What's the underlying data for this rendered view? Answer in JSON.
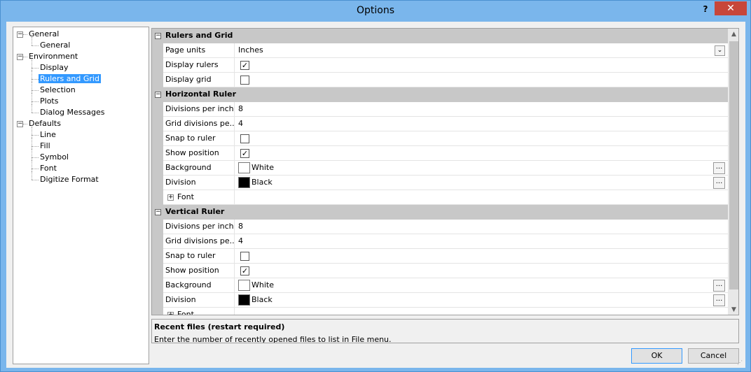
{
  "window": {
    "title": "Options",
    "help_label": "?",
    "close_label": "✕"
  },
  "tree": [
    {
      "label": "General",
      "level": 0,
      "expander": "−"
    },
    {
      "label": "General",
      "level": 1
    },
    {
      "label": "Environment",
      "level": 0,
      "expander": "−"
    },
    {
      "label": "Display",
      "level": 1
    },
    {
      "label": "Rulers and Grid",
      "level": 1,
      "selected": true
    },
    {
      "label": "Selection",
      "level": 1
    },
    {
      "label": "Plots",
      "level": 1
    },
    {
      "label": "Dialog Messages",
      "level": 1
    },
    {
      "label": "Defaults",
      "level": 0,
      "expander": "−"
    },
    {
      "label": "Line",
      "level": 1
    },
    {
      "label": "Fill",
      "level": 1
    },
    {
      "label": "Symbol",
      "level": 1
    },
    {
      "label": "Font",
      "level": 1
    },
    {
      "label": "Digitize Format",
      "level": 1
    }
  ],
  "grid": {
    "rows": [
      {
        "kind": "category",
        "label": "Rulers and Grid",
        "toggle": "−"
      },
      {
        "kind": "combo",
        "name": "Page units",
        "value": "Inches"
      },
      {
        "kind": "check",
        "name": "Display rulers",
        "checked": true
      },
      {
        "kind": "check",
        "name": "Display grid",
        "checked": false
      },
      {
        "kind": "category",
        "label": "Horizontal Ruler",
        "toggle": "−"
      },
      {
        "kind": "text",
        "name": "Divisions per inch",
        "value": "8"
      },
      {
        "kind": "text",
        "name": "Grid divisions pe...",
        "value": "4"
      },
      {
        "kind": "check",
        "name": "Snap to ruler",
        "checked": false
      },
      {
        "kind": "check",
        "name": "Show position",
        "checked": true
      },
      {
        "kind": "color",
        "name": "Background",
        "value": "White",
        "swatch": "#ffffff"
      },
      {
        "kind": "color",
        "name": "Division",
        "value": "Black",
        "swatch": "#000000"
      },
      {
        "kind": "expand",
        "name": "Font"
      },
      {
        "kind": "category",
        "label": "Vertical Ruler",
        "toggle": "−"
      },
      {
        "kind": "text",
        "name": "Divisions per inch",
        "value": "8"
      },
      {
        "kind": "text",
        "name": "Grid divisions pe...",
        "value": "4"
      },
      {
        "kind": "check",
        "name": "Snap to ruler",
        "checked": false
      },
      {
        "kind": "check",
        "name": "Show position",
        "checked": true
      },
      {
        "kind": "color",
        "name": "Background",
        "value": "White",
        "swatch": "#ffffff"
      },
      {
        "kind": "color",
        "name": "Division",
        "value": "Black",
        "swatch": "#000000"
      },
      {
        "kind": "expand",
        "name": "Font"
      }
    ],
    "check_glyph": "✓",
    "ellipsis_label": "...",
    "combo_glyph": "⌄",
    "plus_glyph": "+"
  },
  "scrollbar": {
    "up": "▲",
    "down": "▼"
  },
  "description": {
    "title": "Recent files (restart required)",
    "text": "Enter the number of recently opened files to list in File menu."
  },
  "buttons": {
    "ok": "OK",
    "cancel": "Cancel"
  },
  "colors": {
    "selection": "#3399ff",
    "category_bg": "#c8c8c8",
    "close_bg": "#c7463a",
    "frame": "#7ab6ec"
  }
}
